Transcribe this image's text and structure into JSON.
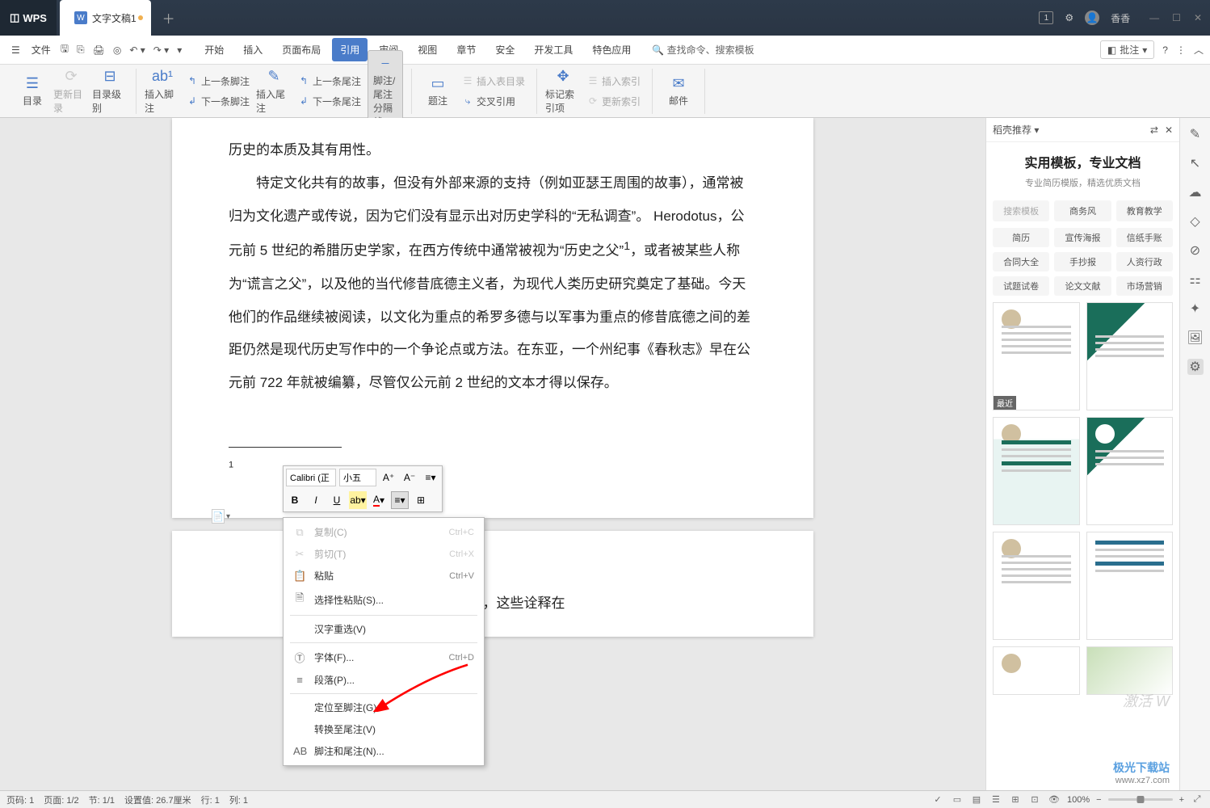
{
  "titlebar": {
    "app": "WPS",
    "tab_label": "文字文稿1",
    "user": "香香"
  },
  "menubar": {
    "file": "文件",
    "tabs": [
      "开始",
      "插入",
      "页面布局",
      "引用",
      "审阅",
      "视图",
      "章节",
      "安全",
      "开发工具",
      "特色应用"
    ],
    "active_index": 3,
    "search": "查找命令、搜索模板",
    "batch": "批注"
  },
  "ribbon": {
    "toc": "目录",
    "update_toc": "更新目录",
    "toc_level": "目录级别",
    "insert_footnote": "插入脚注",
    "prev_footnote": "上一条脚注",
    "next_footnote": "下一条脚注",
    "insert_endnote": "插入尾注",
    "prev_endnote": "上一条尾注",
    "next_endnote": "下一条尾注",
    "fn_separator": "脚注/尾注分隔线",
    "caption": "题注",
    "insert_table_of_figures": "插入表目录",
    "cross_ref": "交叉引用",
    "mark_index": "标记索引项",
    "insert_index": "插入索引",
    "update_index": "更新索引",
    "mail": "邮件"
  },
  "document": {
    "para1": "历史的本质及其有用性。",
    "para2_a": "　　特定文化共有的故事，但没有外部来源的支持（例如亚瑟王周围的故事），通常被归为文化遗产或传说，因为它们没有显示出对历史学科的“无私调查”。 Herodotus，公元前 5 世纪的希腊历史学家，在西方传统中通常被视为“历史之父”",
    "sup": "1",
    "para2_b": "，或者被某些人称为“谎言之父”，以及他的当代修昔底德主义者，为现代人类历史研究奠定了基础。今天他们的作品继续被阅读，以文化为重点的希罗多德与以军事为重点的修昔底德之间的差距仍然是现代历史写作中的一个争论点或方法。在东亚，一个州纪事《春秋志》早在公元前 722 年就被编纂，尽管仅公元前 2 世纪的文本才得以保存。",
    "footnote_mark": "1",
    "page2_text": "史本质的不同诠释，这些诠释在"
  },
  "mini_toolbar": {
    "font": "Calibri (正",
    "size": "小五"
  },
  "context_menu": {
    "copy": "复制(C)",
    "copy_sc": "Ctrl+C",
    "cut": "剪切(T)",
    "cut_sc": "Ctrl+X",
    "paste": "粘贴",
    "paste_sc": "Ctrl+V",
    "paste_special": "选择性粘贴(S)...",
    "reconvert": "汉字重选(V)",
    "font": "字体(F)...",
    "font_sc": "Ctrl+D",
    "paragraph": "段落(P)...",
    "goto_footnote": "定位至脚注(G)",
    "convert_endnote": "转换至尾注(V)",
    "footnote_endnote": "脚注和尾注(N)..."
  },
  "sidebar": {
    "title": "稻壳推荐",
    "hero_title": "实用模板，专业文档",
    "hero_sub": "专业简历模版，精选优质文档",
    "search_placeholder": "搜索模板",
    "tabs": [
      "商务风",
      "教育教学"
    ],
    "cats": [
      "简历",
      "宣传海报",
      "信纸手账",
      "合同大全",
      "手抄报",
      "人资行政",
      "试题试卷",
      "论文文献",
      "市场营销"
    ],
    "recent_badge": "最近"
  },
  "statusbar": {
    "page_no": "页码: 1",
    "page": "页面: 1/2",
    "section": "节: 1/1",
    "pos": "设置值: 26.7厘米",
    "line": "行: 1",
    "col": "列: 1",
    "zoom": "100%"
  },
  "watermarks": {
    "activate": "激活 W",
    "site1": "极光下载站",
    "site2": "www.xz7.com"
  }
}
